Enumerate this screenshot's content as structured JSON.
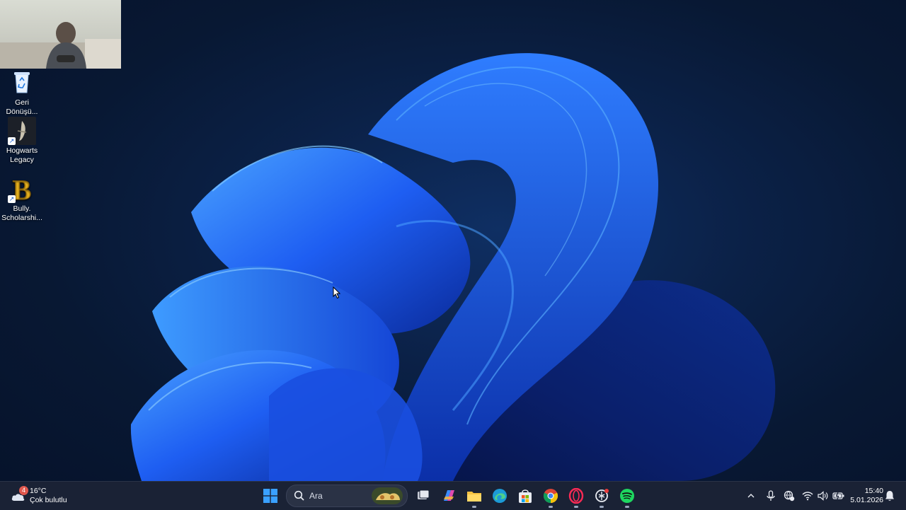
{
  "desktop": {
    "icons": [
      {
        "label_line1": "Geri",
        "label_line2": "Dönüşü..."
      },
      {
        "label_line1": "Hogwarts",
        "label_line2": "Legacy"
      },
      {
        "label_line1": "Bully.",
        "label_line2": "Scholarshi..."
      }
    ]
  },
  "taskbar": {
    "weather": {
      "badge": "4",
      "temp": "16°C",
      "condition": "Çok bulutlu"
    },
    "search": {
      "label": "Ara"
    },
    "pinned_apps": [
      "start-menu",
      "search",
      "task-view",
      "copilot",
      "file-explorer",
      "edge",
      "microsoft-store",
      "chrome",
      "opera",
      "chatgpt",
      "spotify"
    ],
    "clock": {
      "time": "15:40",
      "date": "5.01.2026"
    }
  },
  "colors": {
    "taskbar_bg": "#1a2235",
    "accent": "#1e6fe0",
    "wallpaper_bloom": "#1f5ef0"
  }
}
